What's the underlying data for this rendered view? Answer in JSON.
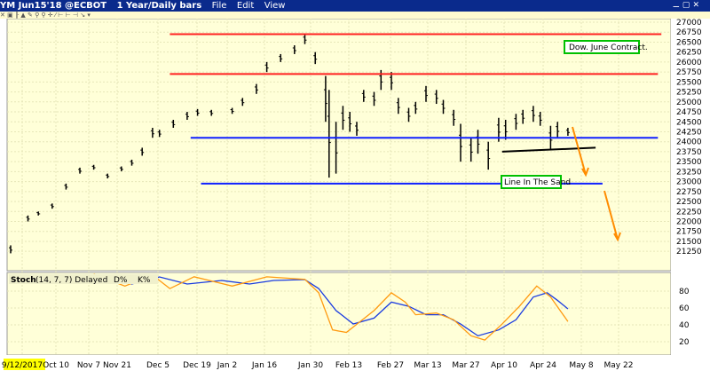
{
  "window": {
    "symbol": "YM Jun15'18 @ECBOT",
    "period": "1 Year/Daily bars",
    "menu": [
      "File",
      "Edit",
      "View"
    ],
    "controls": "⚊ ▢ ✕"
  },
  "toolbar": {
    "icons": "✕ ▣ ╟ ▲ ✎ ⚲ ⚲ ✛ ⁄ ⊢ ⊢ ⊣ ↘ ▾"
  },
  "chart_data": [
    {
      "type": "bar",
      "title": "YM Jun15'18 1 Year/Daily bars",
      "yaxis": {
        "ticks": [
          27000,
          26750,
          26500,
          26250,
          26000,
          25750,
          25500,
          25250,
          25000,
          24750,
          24500,
          24250,
          24000,
          23750,
          23500,
          23250,
          23000,
          22750,
          22500,
          22250,
          22000,
          21750,
          21500,
          21250
        ],
        "ylim": [
          21250,
          27000
        ]
      },
      "bars_t_high_low": [
        [
          0,
          21400,
          21200
        ],
        [
          5,
          22150,
          22000
        ],
        [
          8,
          22250,
          22150
        ],
        [
          12,
          22450,
          22320
        ],
        [
          16,
          22950,
          22800
        ],
        [
          20,
          23350,
          23200
        ],
        [
          24,
          23420,
          23300
        ],
        [
          28,
          23200,
          23080
        ],
        [
          32,
          23380,
          23260
        ],
        [
          35,
          23550,
          23400
        ],
        [
          38,
          23850,
          23650
        ],
        [
          41,
          24350,
          24100
        ],
        [
          43,
          24300,
          24120
        ],
        [
          47,
          24550,
          24350
        ],
        [
          51,
          24750,
          24550
        ],
        [
          54,
          24820,
          24650
        ],
        [
          58,
          24800,
          24650
        ],
        [
          64,
          24850,
          24700
        ],
        [
          67,
          25100,
          24900
        ],
        [
          71,
          25450,
          25200
        ],
        [
          74,
          26000,
          25750
        ],
        [
          78,
          26200,
          26000
        ],
        [
          82,
          26420,
          26200
        ],
        [
          85,
          26700,
          26450
        ],
        [
          88,
          26250,
          25950
        ],
        [
          91,
          25650,
          24500
        ],
        [
          92,
          25300,
          23100
        ],
        [
          94,
          24500,
          23200
        ],
        [
          96,
          24900,
          24300
        ],
        [
          98,
          24750,
          24250
        ],
        [
          100,
          24500,
          24150
        ],
        [
          102,
          25300,
          25000
        ],
        [
          105,
          25250,
          24900
        ],
        [
          107,
          25800,
          25300
        ],
        [
          110,
          25750,
          25300
        ],
        [
          112,
          25100,
          24700
        ],
        [
          115,
          24850,
          24500
        ],
        [
          117,
          25000,
          24700
        ],
        [
          120,
          25400,
          25000
        ],
        [
          123,
          25300,
          24950
        ],
        [
          125,
          25050,
          24700
        ],
        [
          128,
          24800,
          24400
        ],
        [
          130,
          24450,
          23500
        ],
        [
          133,
          24100,
          23500
        ],
        [
          135,
          24300,
          23700
        ],
        [
          138,
          24000,
          23300
        ],
        [
          141,
          24600,
          24000
        ],
        [
          143,
          24550,
          24050
        ],
        [
          146,
          24700,
          24300
        ],
        [
          148,
          24800,
          24450
        ],
        [
          151,
          24900,
          24500
        ],
        [
          153,
          24750,
          24400
        ],
        [
          156,
          24400,
          23800
        ],
        [
          158,
          24500,
          24100
        ],
        [
          161,
          24350,
          24150
        ]
      ],
      "annotations": [
        {
          "type": "hline",
          "price": 26700,
          "t": [
            46,
            188
          ],
          "color": "#ff2020"
        },
        {
          "type": "hline",
          "price": 25700,
          "t": [
            46,
            187
          ],
          "color": "#ff2020"
        },
        {
          "type": "hline",
          "price": 24100,
          "t": [
            52,
            187
          ],
          "color": "#1020ff"
        },
        {
          "type": "hline",
          "price": 22950,
          "t": [
            55,
            171
          ],
          "color": "#1020ff"
        },
        {
          "type": "trend",
          "p": [
            [
              142,
              23750
            ],
            [
              169,
              23850
            ]
          ],
          "color": "#000000"
        }
      ],
      "labels": {
        "dow": "Dow. June Contract.",
        "sand": "Line In The Sand"
      }
    },
    {
      "type": "line",
      "title": "Stoch",
      "params": "(14, 7, 7) Delayed",
      "legend": [
        "D%",
        "K%"
      ],
      "yaxis": {
        "ticks": [
          80,
          60,
          40,
          20
        ],
        "ylim": [
          0,
          100
        ]
      },
      "series": [
        {
          "name": "D%",
          "color": "#1a3be0",
          "points": [
            [
              24,
              96.8
            ],
            [
              35,
              88.4
            ],
            [
              43,
              96.8
            ],
            [
              51,
              88.4
            ],
            [
              61,
              92.6
            ],
            [
              69,
              88.4
            ],
            [
              76,
              92.6
            ],
            [
              85,
              93.7
            ],
            [
              89,
              83
            ],
            [
              94,
              57
            ],
            [
              99,
              41
            ],
            [
              105,
              48
            ],
            [
              110,
              67
            ],
            [
              115,
              62
            ],
            [
              120,
              52
            ],
            [
              125,
              52
            ],
            [
              130,
              41
            ],
            [
              135,
              27
            ],
            [
              141,
              34
            ],
            [
              146,
              46
            ],
            [
              151,
              73
            ],
            [
              155,
              78
            ],
            [
              158,
              69
            ],
            [
              161,
              59
            ]
          ]
        },
        {
          "name": "K%",
          "color": "#ff9a10",
          "points": [
            [
              24,
              100
            ],
            [
              33,
              86
            ],
            [
              41,
              99
            ],
            [
              46,
              83
            ],
            [
              53,
              97
            ],
            [
              64,
              86
            ],
            [
              74,
              97
            ],
            [
              85,
              94
            ],
            [
              89,
              78
            ],
            [
              93,
              34
            ],
            [
              97,
              31
            ],
            [
              101,
              44
            ],
            [
              105,
              57
            ],
            [
              110,
              78
            ],
            [
              114,
              67
            ],
            [
              117,
              52
            ],
            [
              123,
              54
            ],
            [
              128,
              46
            ],
            [
              133,
              27
            ],
            [
              137,
              22
            ],
            [
              142,
              41
            ],
            [
              147,
              62
            ],
            [
              152,
              86
            ],
            [
              156,
              73
            ],
            [
              161,
              44
            ]
          ]
        }
      ]
    }
  ],
  "xaxis": {
    "labels": [
      "9/12/2017",
      "Oct 10",
      "Nov 7",
      "Nov 21",
      "Dec 5",
      "Dec 19",
      "Jan 2",
      "Jan 16",
      "Jan 30",
      "Feb 13",
      "Feb 27",
      "Mar 13",
      "Mar 27",
      "Apr 10",
      "Apr 24",
      "May 8",
      "May 22"
    ]
  },
  "colors": {
    "bg": "#ffffd8",
    "grid": "#e6e6b8",
    "highlight": "#ffff00",
    "arrow": "#ff8c00",
    "box": "#00c000"
  }
}
